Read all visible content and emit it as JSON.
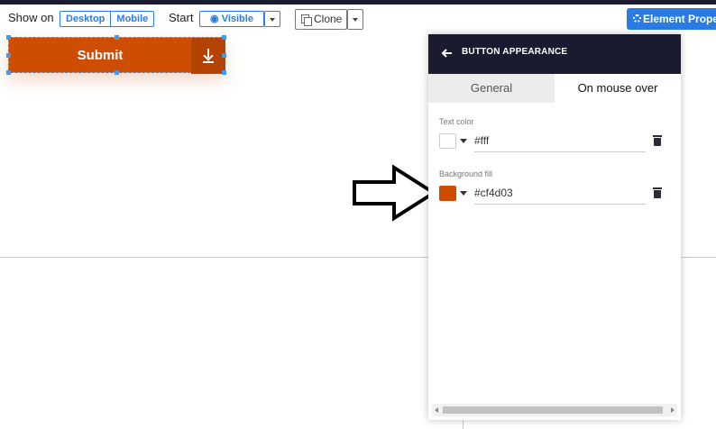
{
  "toolbar": {
    "show_on_label": "Show on",
    "desktop_label": "Desktop",
    "mobile_label": "Mobile",
    "start_label": "Start",
    "visible_label": "Visible",
    "clone_label": "Clone",
    "element_properties_label": "Element Properties"
  },
  "canvas": {
    "submit_label": "Submit",
    "submit_color": "#cf4d03"
  },
  "panel": {
    "title": "BUTTON APPEARANCE",
    "tabs": [
      {
        "label": "General",
        "active": false
      },
      {
        "label": "On mouse over",
        "active": true
      }
    ],
    "text_color": {
      "label": "Text color",
      "value": "#fff",
      "swatch": "#ffffff"
    },
    "background_fill": {
      "label": "Background fill",
      "value": "#cf4d03",
      "swatch": "#cf4d03"
    }
  }
}
